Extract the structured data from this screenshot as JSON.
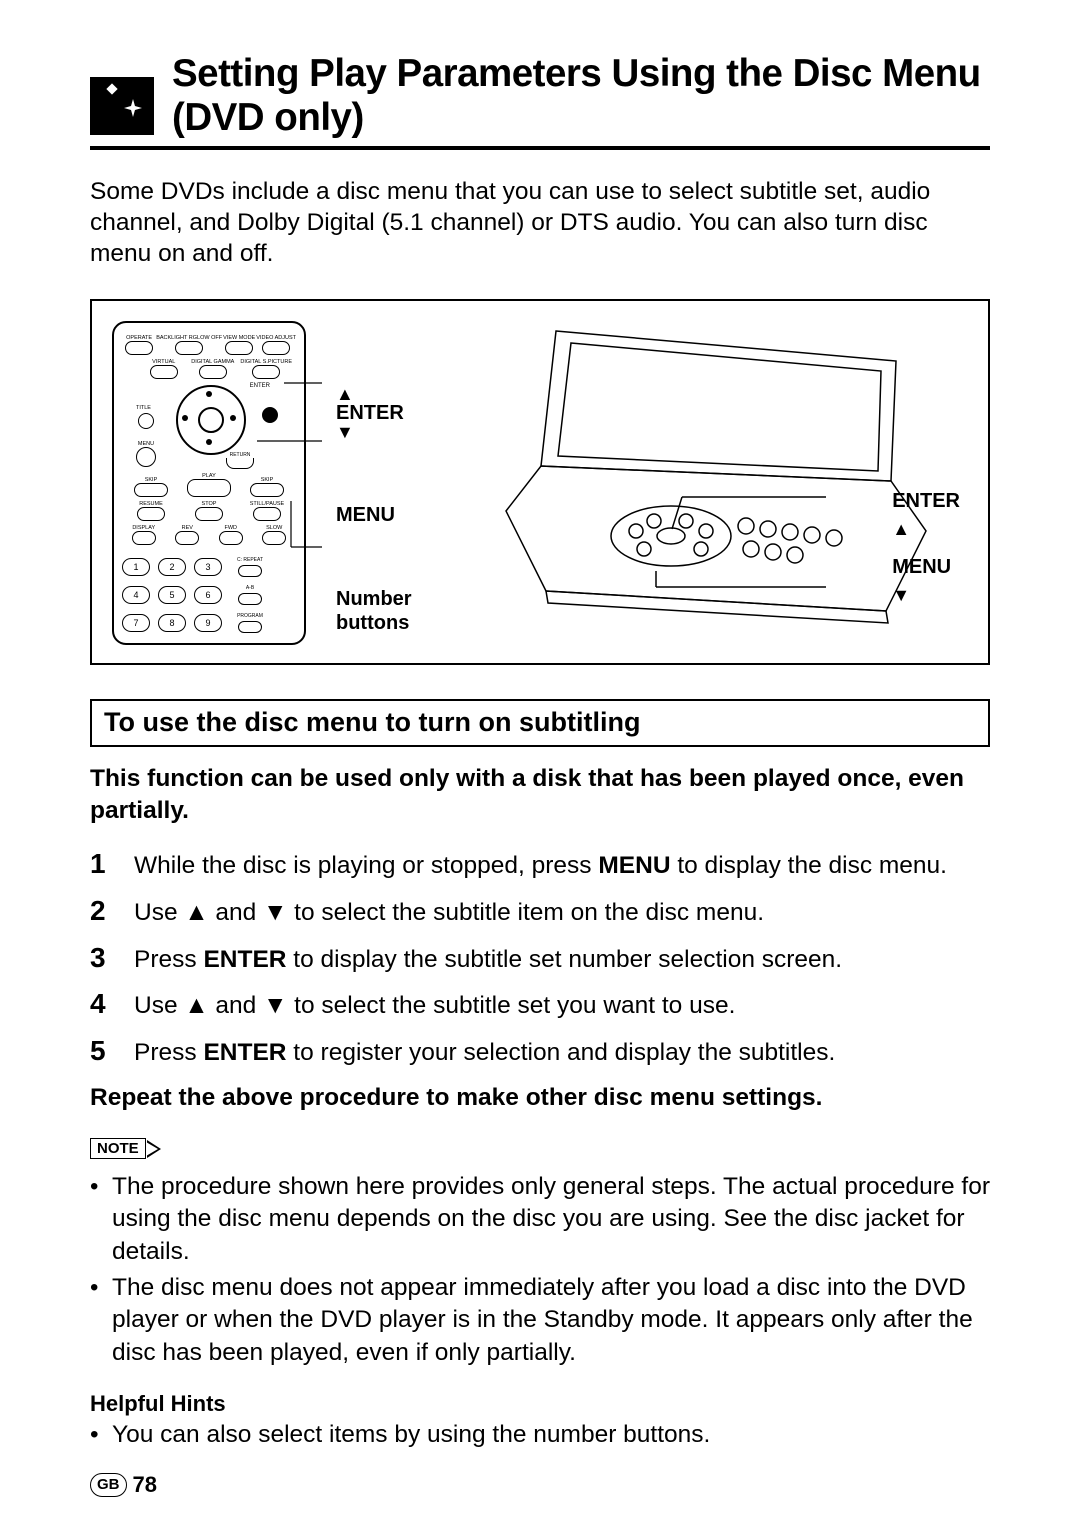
{
  "header": {
    "title": "Setting Play Parameters Using the Disc Menu (DVD only)"
  },
  "intro": "Some DVDs include a disc menu that you can use to select subtitle set, audio channel, and Dolby Digital (5.1 channel) or DTS audio. You can also turn disc menu on and off.",
  "diagram": {
    "remote_buttons_top": [
      {
        "label": "OPERATE"
      },
      {
        "label": "BACKLIGHT RGLOW OFF"
      },
      {
        "label": "VIEW MODE"
      },
      {
        "label": "VIDEO ADJUST"
      }
    ],
    "remote_buttons_row2": [
      {
        "label": "VIRTUAL"
      },
      {
        "label": "DIGITAL GAMMA"
      },
      {
        "label": "DIGITAL S.PICTURE"
      }
    ],
    "dpad": {
      "title": "TITLE",
      "enter": "ENTER",
      "menu": "MENU",
      "return": "RETURN"
    },
    "transport_row": [
      {
        "label": "SKIP"
      },
      {
        "label": "PLAY"
      },
      {
        "label": "SKIP"
      }
    ],
    "transport_row2": [
      {
        "label": "RESUME"
      },
      {
        "label": "STOP"
      },
      {
        "label": "STILL/PAUSE"
      }
    ],
    "transport_row3": [
      {
        "label": "DISPLAY"
      },
      {
        "label": "REV"
      },
      {
        "label": "FWD"
      },
      {
        "label": "SLOW"
      }
    ],
    "keypad_side": [
      {
        "label": "C: REPEAT"
      },
      {
        "label": "A-B"
      },
      {
        "label": "PROGRAM"
      }
    ],
    "numbers": [
      "1",
      "2",
      "3",
      "4",
      "5",
      "6",
      "7",
      "8",
      "9"
    ],
    "remote_callouts": {
      "enter": "ENTER",
      "menu": "MENU",
      "number_l1": "Number",
      "number_l2": "buttons"
    },
    "player_callouts": {
      "enter": "ENTER",
      "menu": "MENU"
    }
  },
  "section_title": "To use the disc menu to turn on subtitling",
  "precondition": "This function can be used only with a disk that has been played once, even partially.",
  "steps": [
    {
      "n": "1",
      "pre": "While the disc is playing or stopped, press ",
      "bold": "MENU",
      "post": " to display the disc menu."
    },
    {
      "n": "2",
      "pre": "Use ▲ and ▼ to select the subtitle item on the disc menu.",
      "bold": "",
      "post": ""
    },
    {
      "n": "3",
      "pre": "Press ",
      "bold": "ENTER",
      "post": " to display the subtitle set number selection screen."
    },
    {
      "n": "4",
      "pre": "Use ▲ and ▼ to select the subtitle set you want to use.",
      "bold": "",
      "post": ""
    },
    {
      "n": "5",
      "pre": "Press ",
      "bold": "ENTER",
      "post": " to register your selection and display the subtitles."
    }
  ],
  "repeat_line": "Repeat the above procedure to make other disc menu settings.",
  "note_label": "NOTE",
  "notes": [
    "The procedure shown here provides only general steps. The actual procedure for using the disc menu depends on the disc you are using. See the disc jacket for details.",
    "The disc menu does not appear immediately after you load a disc into the DVD player or when the DVD player is in the Standby mode. It appears only after the disc has been played, even if only partially."
  ],
  "hints_title": "Helpful Hints",
  "hints": [
    "You can also select items by using the number buttons."
  ],
  "footer": {
    "region": "GB",
    "page": "78"
  }
}
